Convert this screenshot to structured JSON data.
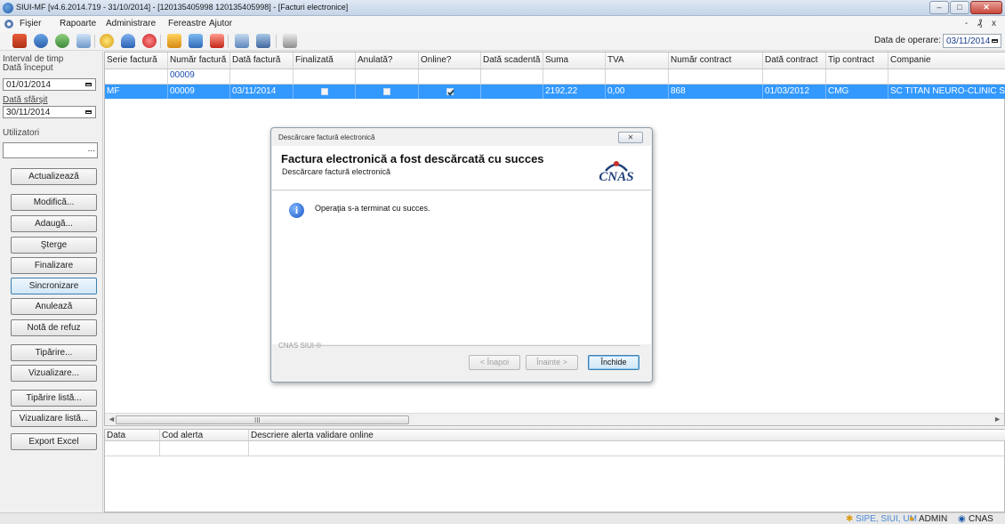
{
  "window": {
    "title": "SIUI-MF [v4.6.2014.719 - 31/10/2014] - [120135405998 120135405998] - [Facturi electronice]",
    "controls": {
      "minimize": "–",
      "maximize": "□",
      "close": "✕"
    }
  },
  "menu": {
    "items": [
      "Fişier",
      "Rapoarte",
      "Administrare",
      "Fereastre",
      "Ajutor"
    ],
    "mdi_controls": "- ₰ x"
  },
  "toolbar": {
    "icons": [
      "users-icon",
      "database-icon",
      "cycle-icon",
      "check-doc-icon",
      "smile-icon",
      "person-icon",
      "medical-cross-icon",
      "pills-icon",
      "bottle-icon",
      "document-red-icon",
      "settings-doc-icon",
      "stack-icon",
      "print-icon"
    ],
    "operation_date_label": "Data de operare:",
    "operation_date_value": "03/11/2014"
  },
  "left_panel": {
    "interval_label": "Interval de timp",
    "start_label": "Dată început",
    "start_value": "01/01/2014",
    "end_label": "Dată sfârşit",
    "end_value": "30/11/2014",
    "users_label": "Utilizatori",
    "users_ellipsis": "...",
    "buttons": [
      "Actualizează",
      "Modifică...",
      "Adaugă...",
      "Şterge",
      "Finalizare",
      "Sincronizare",
      "Anulează",
      "Notă de refuz",
      "Tipărire...",
      "Vizualizare...",
      "Tipărire listă...",
      "Vizualizare listă...",
      "Export Excel"
    ]
  },
  "grid": {
    "columns": [
      "Serie factură",
      "Număr factură",
      "Dată factură",
      "Finalizată",
      "Anulată?",
      "Online?",
      "Dată scadentă",
      "Suma",
      "TVA",
      "Număr contract",
      "Dată contract",
      "Tip contract",
      "Companie"
    ],
    "filter_value": "00009",
    "row": {
      "serie": "MF",
      "numar": "00009",
      "data": "03/11/2014",
      "finalizata": false,
      "anulata": false,
      "online": true,
      "scadenta": "",
      "suma": "2192,22",
      "tva": "0,00",
      "contract": "868",
      "data_contract": "01/03/2012",
      "tip_contract": "CMG",
      "companie": "SC TITAN NEURO-CLINIC SRL"
    },
    "scroll_left": "◄",
    "scroll_right": "►",
    "scroll_grip": "III"
  },
  "alerts_grid": {
    "columns": [
      "Data",
      "Cod alerta",
      "Descriere alerta validare online"
    ]
  },
  "status_bar": {
    "left": "SIPE, SIUI, UM",
    "user": "ADMIN",
    "org": "CNAS"
  },
  "dialog": {
    "title": "Descărcare factură electronică",
    "close": "✕",
    "heading": "Factura electronică a fost descărcată cu succes",
    "subheading": "Descărcare factură electronică",
    "logo_text": "CNAS",
    "message": "Operaţia s-a terminat cu succes.",
    "footer_label": "CNAS SIUI ®",
    "back_button": "< Înapoi",
    "next_button": "Înainte >",
    "close_button": "Închide"
  },
  "colors": {
    "selection": "#3399ff",
    "filter_text": "#1d4cb0",
    "status_link": "#4a8ad6"
  }
}
